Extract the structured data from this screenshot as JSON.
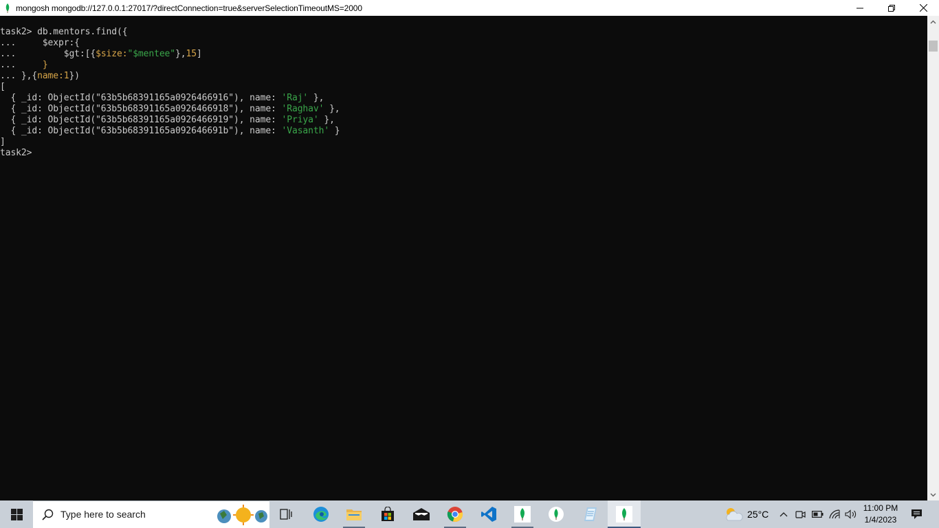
{
  "window": {
    "title": "mongosh mongodb://127.0.0.1:27017/?directConnection=true&serverSelectionTimeoutMS=2000",
    "controls": [
      "minimize-icon",
      "restore-icon",
      "close-icon"
    ]
  },
  "console": {
    "lines": [
      {
        "segments": [
          {
            "text": "task2> db.mentors.find({",
            "color": "white"
          }
        ]
      },
      {
        "segments": [
          {
            "text": "...     $expr:{",
            "color": "white"
          }
        ]
      },
      {
        "segments": [
          {
            "text": "...         $gt:[{",
            "color": "white"
          },
          {
            "text": "$size:",
            "color": "orange"
          },
          {
            "text": "\"$mentee\"",
            "color": "green"
          },
          {
            "text": "},",
            "color": "white"
          },
          {
            "text": "15",
            "color": "orange"
          },
          {
            "text": "]",
            "color": "white"
          }
        ]
      },
      {
        "segments": [
          {
            "text": "...     ",
            "color": "white"
          },
          {
            "text": "}",
            "color": "orange"
          }
        ]
      },
      {
        "segments": [
          {
            "text": "... },{",
            "color": "white"
          },
          {
            "text": "name:1",
            "color": "orange"
          },
          {
            "text": "})",
            "color": "white"
          }
        ]
      },
      {
        "segments": [
          {
            "text": "[",
            "color": "white"
          }
        ]
      },
      {
        "segments": [
          {
            "text": "  { _id: ObjectId(\"63b5b68391165a0926466916\"), name: ",
            "color": "white"
          },
          {
            "text": "'Raj'",
            "color": "green"
          },
          {
            "text": " },",
            "color": "white"
          }
        ]
      },
      {
        "segments": [
          {
            "text": "  { _id: ObjectId(\"63b5b68391165a0926466918\"), name: ",
            "color": "white"
          },
          {
            "text": "'Raghav'",
            "color": "green"
          },
          {
            "text": " },",
            "color": "white"
          }
        ]
      },
      {
        "segments": [
          {
            "text": "  { _id: ObjectId(\"63b5b68391165a0926466919\"), name: ",
            "color": "white"
          },
          {
            "text": "'Priya'",
            "color": "green"
          },
          {
            "text": " },",
            "color": "white"
          }
        ]
      },
      {
        "segments": [
          {
            "text": "  { _id: ObjectId(\"63b5b68391165a092646691b\"), name: ",
            "color": "white"
          },
          {
            "text": "'Vasanth'",
            "color": "green"
          },
          {
            "text": " }",
            "color": "white"
          }
        ]
      },
      {
        "segments": [
          {
            "text": "]",
            "color": "white"
          }
        ]
      },
      {
        "segments": [
          {
            "text": "task2> ",
            "color": "white"
          }
        ]
      }
    ]
  },
  "taskbar": {
    "search_placeholder": "Type here to search",
    "pinned": [
      "windows-start-icon",
      "task-view-icon",
      "edge-icon",
      "file-explorer-icon",
      "microsoft-store-icon",
      "mail-icon",
      "chrome-icon",
      "vscode-icon",
      "mongodb-compass-icon",
      "mongodb-compass-icon-2",
      "notepad-icon",
      "mongosh-icon"
    ],
    "weather": {
      "temperature": "25°C",
      "icon": "partly-cloudy-icon"
    },
    "clock": {
      "time": "11:00 PM",
      "date": "1/4/2023"
    }
  },
  "colors": {
    "console_bg": "#0c0c0c",
    "console_text": "#cccccc",
    "syntax_orange": "#d7a548",
    "syntax_green": "#3aa64a",
    "taskbar_bg": "#c9d0d8"
  }
}
